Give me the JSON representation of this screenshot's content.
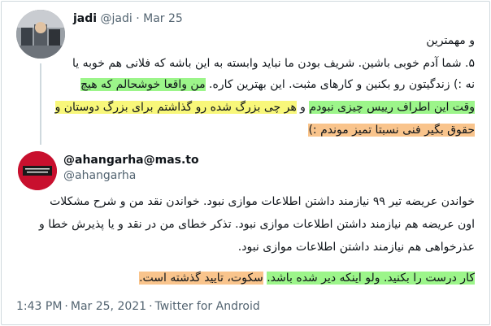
{
  "tweet": {
    "author_name": "jadi",
    "author_handle": "@jadi",
    "separator": "·",
    "date": "Mar 25",
    "lines": [
      {
        "segments": [
          {
            "text": "و مهمترین",
            "hl": ""
          }
        ]
      },
      {
        "segments": [
          {
            "text": "۵. شما آدم خوبی باشین. شریف بودن ما نباید وابسته به این باشه که فلانی هم خوبه یا",
            "hl": ""
          }
        ]
      },
      {
        "segments": [
          {
            "text": "نه :) زندگیتون رو بکنین و کارهای مثبت. این بهترین کاره. ",
            "hl": ""
          },
          {
            "text": "من واقعا خوشحالم که هیچ",
            "hl": "g"
          }
        ]
      },
      {
        "segments": [
          {
            "text": "وقت این اطراف رییس چیزی نبودم",
            "hl": "g"
          },
          {
            "text": " و ",
            "hl": ""
          },
          {
            "text": "هر چی بزرگ شده رو گذاشتم برای بزرگ دوستان و",
            "hl": "y"
          }
        ]
      },
      {
        "segments": [
          {
            "text": "حقوق بگیر فنی نسبتا تمیز موندم :)",
            "hl": "o"
          }
        ]
      }
    ]
  },
  "quoted": {
    "author_name": "@ahangarha@mas.to",
    "author_handle": "@ahangarha",
    "lines": [
      {
        "segments": [
          {
            "text": "خواندن عریضه تیر ۹۹ نیازمند داشتن اطلاعات موازی نبود. خواندن نقد من و شرح مشکلات",
            "hl": ""
          }
        ]
      },
      {
        "segments": [
          {
            "text": "اون عریضه هم نیازمند داشتن اطلاعات موازی نبود. تذکر خطای من در نقد و یا پذیرش خطا و",
            "hl": ""
          }
        ]
      },
      {
        "segments": [
          {
            "text": "عذرخواهی هم نیازمند داشتن اطلاعات موازی نبود.",
            "hl": ""
          }
        ]
      },
      {
        "segments": [
          {
            "text": "کار درست را بکنید. ولو اینکه دیر شده باشد.",
            "hl": "g"
          },
          {
            "text": " ",
            "hl": ""
          },
          {
            "text": "سکوت، تایید گذشته است.",
            "hl": "o"
          }
        ]
      }
    ]
  },
  "footer": {
    "time": "1:43 PM",
    "date": "Mar 25, 2021",
    "client": "Twitter for Android",
    "separator": "·"
  },
  "colors": {
    "highlight_green": "#9cf58a",
    "highlight_yellow": "#f8f77a",
    "highlight_orange": "#f9c48c",
    "secondary_text": "#536471",
    "avatar2_bg": "#c8102e"
  }
}
